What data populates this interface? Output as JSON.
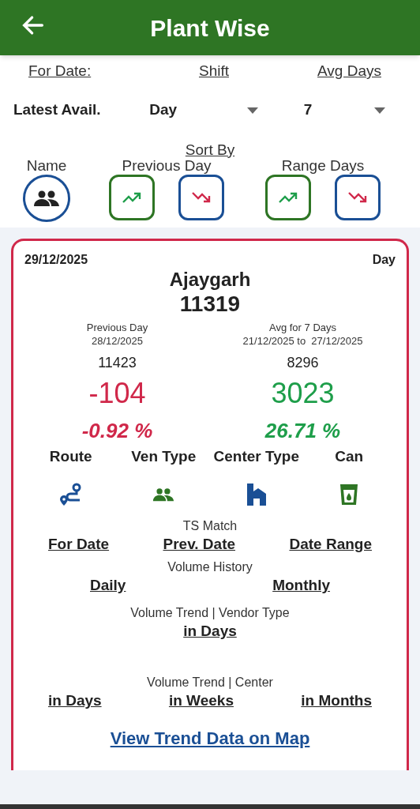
{
  "header": {
    "title": "Plant Wise"
  },
  "filters": {
    "labels": [
      "For Date:",
      "Shift",
      "Avg Days"
    ],
    "values": [
      {
        "kind": "text",
        "value": "Latest Avail."
      },
      {
        "kind": "dropdown",
        "value": "Day"
      },
      {
        "kind": "dropdown",
        "value": "7"
      }
    ]
  },
  "sort": {
    "title": "Sort By",
    "groups": [
      {
        "label": "Name",
        "buttons": [
          {
            "kind": "name"
          }
        ]
      },
      {
        "label": "Previous Day",
        "buttons": [
          {
            "kind": "up"
          },
          {
            "kind": "down"
          }
        ]
      },
      {
        "label": "Range Days",
        "buttons": [
          {
            "kind": "up"
          },
          {
            "kind": "down"
          }
        ]
      }
    ]
  },
  "card": {
    "date": "29/12/2025",
    "shift": "Day",
    "name": "Ajaygarh",
    "total": "11319",
    "compare": [
      {
        "label": "Previous Day",
        "sublabel": "28/12/2025",
        "base": "11423",
        "diff": "-104",
        "percent": "-0.92 %",
        "color": "#d0284a"
      },
      {
        "label": "Avg for 7 Days",
        "sublabel": "21/12/2025 to  27/12/2025",
        "base": "8296",
        "diff": "3023",
        "percent": "26.71 %",
        "color": "#1e9e4a"
      }
    ],
    "categories": [
      {
        "label": "Route",
        "kind": "route"
      },
      {
        "label": "Ven Type",
        "kind": "vendor"
      },
      {
        "label": "Center Type",
        "kind": "center"
      },
      {
        "label": "Can",
        "kind": "can"
      }
    ],
    "sections": [
      {
        "title": "TS Match",
        "links": [
          "For Date",
          "Prev. Date",
          "Date Range"
        ]
      },
      {
        "title": "Volume History",
        "links": [
          "Daily",
          "Monthly"
        ]
      },
      {
        "title": "Volume Trend | Vendor Type",
        "links": [
          "in Days"
        ]
      },
      {
        "title": "Volume Trend | Center",
        "links": [
          "in Days",
          "in Weeks",
          "in Months"
        ]
      }
    ],
    "map_link": "View Trend Data on Map"
  }
}
